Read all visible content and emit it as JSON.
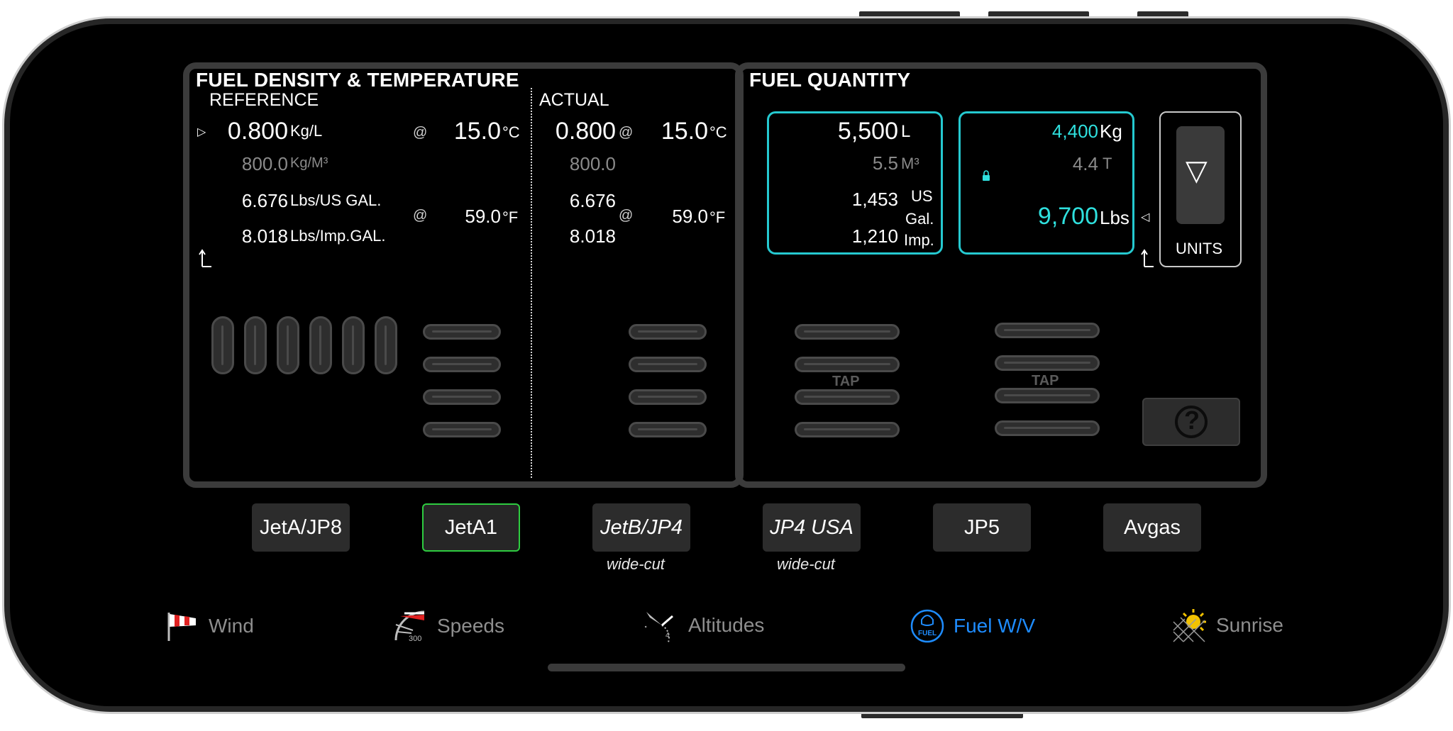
{
  "density_panel": {
    "title": "FUEL DENSITY & TEMPERATURE",
    "reference_label": "REFERENCE",
    "actual_label": "ACTUAL",
    "at_symbol": "@",
    "reference": {
      "kg_l": {
        "value": "0.800",
        "unit": "Kg/L"
      },
      "kg_m3": {
        "value": "800.0",
        "unit": "Kg/M³"
      },
      "lbs_us": {
        "value": "6.676",
        "unit": "Lbs/US GAL."
      },
      "lbs_imp": {
        "value": "8.018",
        "unit": "Lbs/Imp.GAL."
      },
      "temp_c": {
        "value": "15.0",
        "unit": "°C"
      },
      "temp_f": {
        "value": "59.0",
        "unit": "°F"
      }
    },
    "actual": {
      "kg_l": "0.800",
      "kg_m3": "800.0",
      "lbs_us": "6.676",
      "lbs_imp": "8.018",
      "temp_c": {
        "value": "15.0",
        "unit": "°C"
      },
      "temp_f": {
        "value": "59.0",
        "unit": "°F"
      }
    }
  },
  "quantity_panel": {
    "title": "FUEL QUANTITY",
    "volume": {
      "litres": {
        "value": "5,500",
        "unit": "L"
      },
      "m3": {
        "value": "5.5",
        "unit": "M³"
      },
      "us_gal": {
        "value": "1,453",
        "unit": "US"
      },
      "gal_label": "Gal.",
      "imp_gal": {
        "value": "1,210",
        "unit": "Imp."
      }
    },
    "mass": {
      "kg": {
        "value": "4,400",
        "unit": "Kg"
      },
      "t": {
        "value": "4.4",
        "unit": "T"
      },
      "lbs": {
        "value": "9,700",
        "unit": "Lbs"
      }
    },
    "units_button": {
      "symbol": "▽",
      "label": "UNITS"
    },
    "tap_label": "TAP",
    "help_symbol": "?"
  },
  "fuel_types": [
    {
      "label": "JetA/JP8",
      "sub": "",
      "italic": false,
      "selected": false
    },
    {
      "label": "JetA1",
      "sub": "",
      "italic": false,
      "selected": true
    },
    {
      "label": "JetB/JP4",
      "sub": "wide-cut",
      "italic": true,
      "selected": false
    },
    {
      "label": "JP4 USA",
      "sub": "wide-cut",
      "italic": true,
      "selected": false
    },
    {
      "label": "JP5",
      "sub": "",
      "italic": false,
      "selected": false
    },
    {
      "label": "Avgas",
      "sub": "",
      "italic": false,
      "selected": false
    }
  ],
  "tabs": [
    {
      "label": "Wind",
      "icon": "windsock-icon",
      "active": false
    },
    {
      "label": "Speeds",
      "icon": "airspeed-icon",
      "active": false
    },
    {
      "label": "Altitudes",
      "icon": "altimeter-icon",
      "active": false
    },
    {
      "label": "Fuel W/V",
      "icon": "fuel-icon",
      "active": true,
      "icon_text": "FUEL"
    },
    {
      "label": "Sunrise",
      "icon": "sunrise-icon",
      "active": false
    }
  ],
  "colors": {
    "accent_cyan": "#2fe0de",
    "selected_green": "#2ecc40",
    "active_tab_blue": "#1e8cff"
  }
}
